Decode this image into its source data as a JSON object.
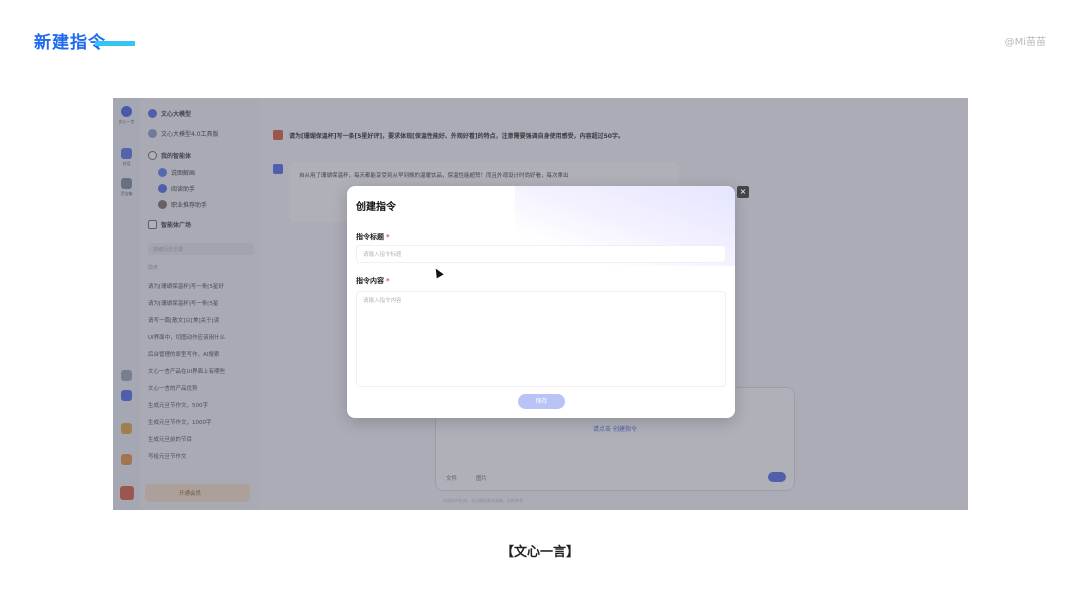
{
  "slide": {
    "title": "新建指令",
    "watermark": "@Mi苗苗",
    "caption": "【文心一言】"
  },
  "app": {
    "rail": [
      {
        "label": "文心一言",
        "icon": "logo-icon"
      },
      {
        "label": "对话",
        "icon": "chat-icon"
      },
      {
        "label": "百宝箱",
        "icon": "toolbox-icon"
      },
      {
        "label": "",
        "icon": "mail-icon"
      },
      {
        "label": "",
        "icon": "shield-icon"
      },
      {
        "label": "",
        "icon": "gift-icon"
      },
      {
        "label": "",
        "icon": "flower-icon"
      }
    ],
    "sidebar": {
      "model": "文心大模型",
      "model_version": "文心大模型4.0工具版",
      "my_agents": "我的智能体",
      "agents": [
        "说图解画",
        "阅读助手",
        "职业推荐助手"
      ],
      "agent_market": "智能体广场",
      "search_placeholder": "搜索历史记录",
      "history_section": "前天",
      "history": [
        "请为[珊瑚保温杯]写一条[5星好",
        "请为[珊瑚保温杯]写一条[5星",
        "请写一篇[散文]以[美]关于[读",
        "UI界面中，切图动作应该用什么",
        "后台管理的原型写作，AI搜索",
        "文心一言产品在UI界面上有哪些",
        "文心一言的产品优势",
        "生成元旦节作文，500字",
        "生成元旦节作文，1000字",
        "生成元旦前的节目",
        "写给元旦节作文"
      ],
      "promo": "开通会员"
    },
    "chat": {
      "user_message": "请为[珊瑚保温杯]写一条[5星好评]，要求体现[保温性能好、外观好看]的特点，注意需要强调自身使用感受，内容超过50字。",
      "answer_preview": "自从用了珊瑚保温杯，每天都能享受到从早到晚的温暖饮品，保温性能超赞！而且外观设计时尚好看，每次拿出",
      "input_hint": "请点击 创建指令",
      "input_tools": [
        "文件",
        "图片"
      ],
      "footer": "内容由AI生成，无法确保真实准确，仅供参考"
    },
    "modal": {
      "title": "创建指令",
      "close": "×",
      "field1_label": "指令标题",
      "field1_placeholder": "请输入指令标题",
      "field2_label": "指令内容",
      "field2_placeholder": "请输入指令内容",
      "required_mark": "*",
      "save": "保存"
    }
  },
  "colors": {
    "accent": "#1f6bf0",
    "title_bar": "#34c4f5",
    "overlay": "#555869",
    "save_button": "#b9c3f5",
    "required": "#e34d4d"
  }
}
